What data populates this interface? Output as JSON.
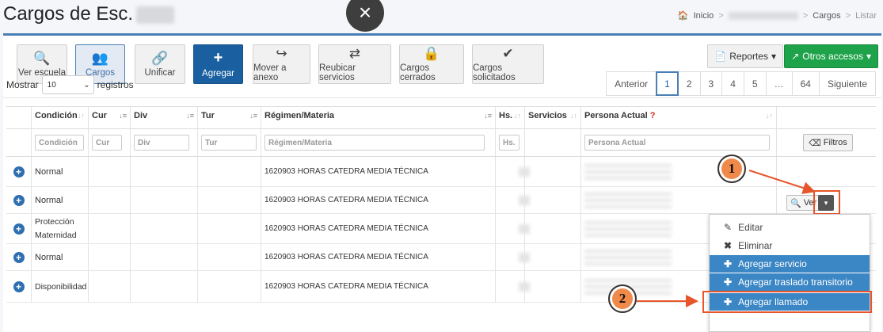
{
  "header": {
    "title": "Cargos de Esc.",
    "close_glyph": "×",
    "breadcrumb": {
      "home": "Inicio",
      "cargos": "Cargos",
      "listar": "Listar",
      "sep": ">"
    }
  },
  "toolbar": {
    "buttons": [
      {
        "label": "Ver escuela",
        "icon": "🔍"
      },
      {
        "label": "Cargos",
        "icon": "👥"
      },
      {
        "label": "Unificar",
        "icon": "🔗"
      },
      {
        "label": "Agregar",
        "icon": "+"
      },
      {
        "label": "Mover a anexo",
        "icon": "↪"
      },
      {
        "label": "Reubicar servicios",
        "icon": "⇄"
      },
      {
        "label": "Cargos cerrados",
        "icon": "🔒"
      },
      {
        "label": "Cargos solicitados",
        "icon": "✔"
      }
    ],
    "reportes": "Reportes",
    "otros": "Otros accesos",
    "caret": "▾"
  },
  "list_controls": {
    "mostrar": "Mostrar",
    "page_size": "10",
    "registros": "registros"
  },
  "pagination": {
    "prev": "Anterior",
    "pages": [
      "1",
      "2",
      "3",
      "4",
      "5",
      "…",
      "64"
    ],
    "next": "Siguiente",
    "current": "1"
  },
  "table": {
    "headers": {
      "condicion": "Condición",
      "cur": "Cur",
      "div": "Div",
      "tur": "Tur",
      "regimen": "Régimen/Materia",
      "hs": "Hs.",
      "servicios": "Servicios",
      "persona": "Persona Actual",
      "persona_q": "?"
    },
    "filters": {
      "condicion": "Condición",
      "cur": "Cur",
      "div": "Div",
      "tur": "Tur",
      "regimen": "Régimen/Materia",
      "hs": "Hs.",
      "persona": "Persona Actual",
      "filtros_btn": "Filtros"
    },
    "rows": [
      {
        "condicion": "Normal",
        "materia": "1620903 HORAS CATEDRA MEDIA TÉCNICA"
      },
      {
        "condicion": "Normal",
        "materia": "1620903 HORAS CATEDRA MEDIA TÉCNICA"
      },
      {
        "condicion": "Protección Maternidad",
        "materia": "1620903 HORAS CATEDRA MEDIA TÉCNICA"
      },
      {
        "condicion": "Normal",
        "materia": "1620903 HORAS CATEDRA MEDIA TÉCNICA"
      },
      {
        "condicion": "Disponibilidad",
        "materia": "1620903 HORAS CATEDRA MEDIA TÉCNICA"
      }
    ],
    "ver_label": "Ver"
  },
  "dropdown": {
    "editar": "Editar",
    "eliminar": "Eliminar",
    "agregar_servicio": "Agregar servicio",
    "agregar_traslado": "Agregar traslado transitorio",
    "agregar_llamado": "Agregar llamado"
  },
  "annotations": {
    "badge1": "1",
    "badge2": "2"
  },
  "colors": {
    "accent": "#4a7fb5",
    "primary": "#1a5fa0",
    "success": "#1fa34a",
    "highlight": "#e8552a",
    "menu_blue": "#3b86c4"
  }
}
